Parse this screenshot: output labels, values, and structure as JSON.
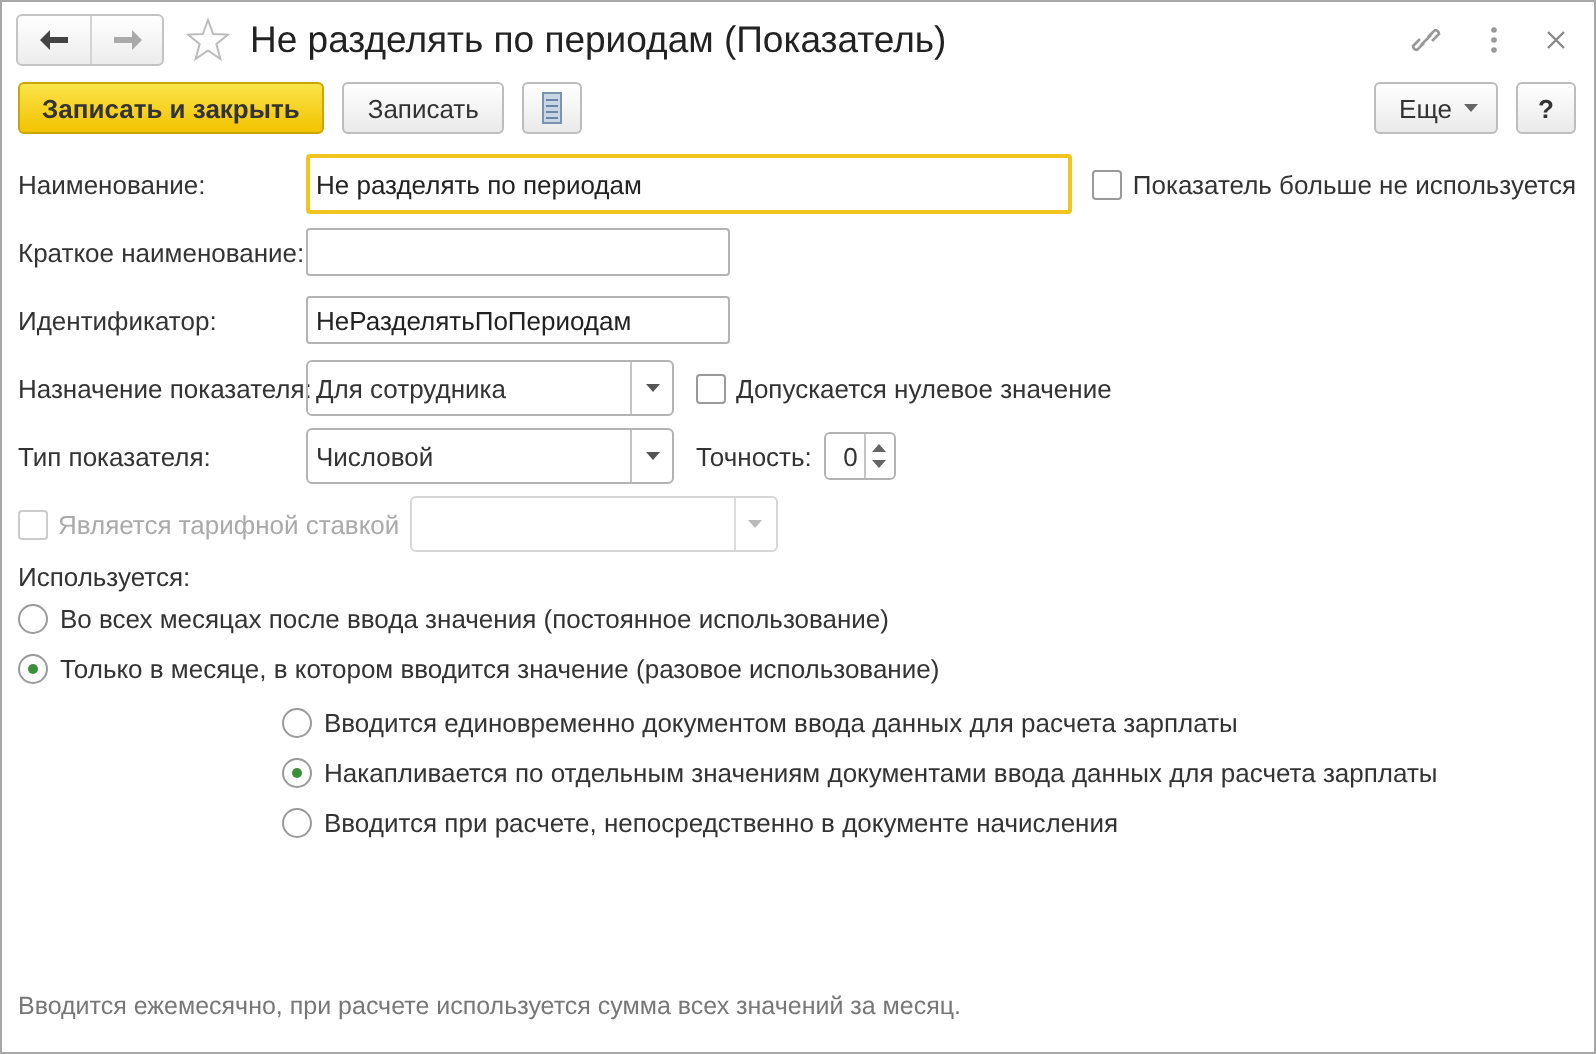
{
  "window": {
    "title": "Не разделять по периодам (Показатель)",
    "favorite": false
  },
  "toolbar": {
    "buttons": [
      {
        "kind": "primary",
        "label": "Записать и закрыть"
      },
      {
        "kind": "normal",
        "label": "Записать"
      },
      {
        "kind": "list"
      }
    ],
    "more": {
      "label": "Еще"
    },
    "help": {
      "label": "?"
    }
  },
  "form": {
    "name": {
      "label": "Наименование:",
      "value": "Не разделять по периодам",
      "focused": true
    },
    "not_used": {
      "label": "Показатель больше не используется",
      "checked": false
    },
    "short_name": {
      "label": "Краткое наименование:",
      "focused": false
    },
    "identifier": {
      "label": "Идентификатор:",
      "value": "НеРазделятьПоПериодам",
      "focused": false
    },
    "purpose": {
      "label": "Назначение показателя:",
      "value": "Для сотрудника"
    },
    "zero_allowed": {
      "label": "Допускается нулевое значение",
      "checked": false
    },
    "type": {
      "label": "Тип показателя:",
      "value": "Числовой"
    },
    "precision": {
      "label": "Точность:",
      "value": "0"
    },
    "tariff": {
      "label": "Является тарифной ставкой",
      "checked": false,
      "disabled": true
    },
    "usage": {
      "label": "Используется:",
      "options": [
        {
          "label": "Во всех месяцах после ввода значения (постоянное использование)",
          "selected": false
        },
        {
          "label": "Только в месяце, в котором вводится значение (разовое использование)",
          "selected": true
        }
      ],
      "sub_options": [
        {
          "label": "Вводится единовременно документом ввода данных для расчета зарплаты",
          "selected": false
        },
        {
          "label": "Накапливается по отдельным значениям документами ввода данных для расчета зарплаты",
          "selected": true
        },
        {
          "label": "Вводится при расчете, непосредственно в документе начисления",
          "selected": false
        }
      ]
    },
    "note": "Вводится ежемесячно, при расчете используется сумма всех значений за месяц."
  }
}
